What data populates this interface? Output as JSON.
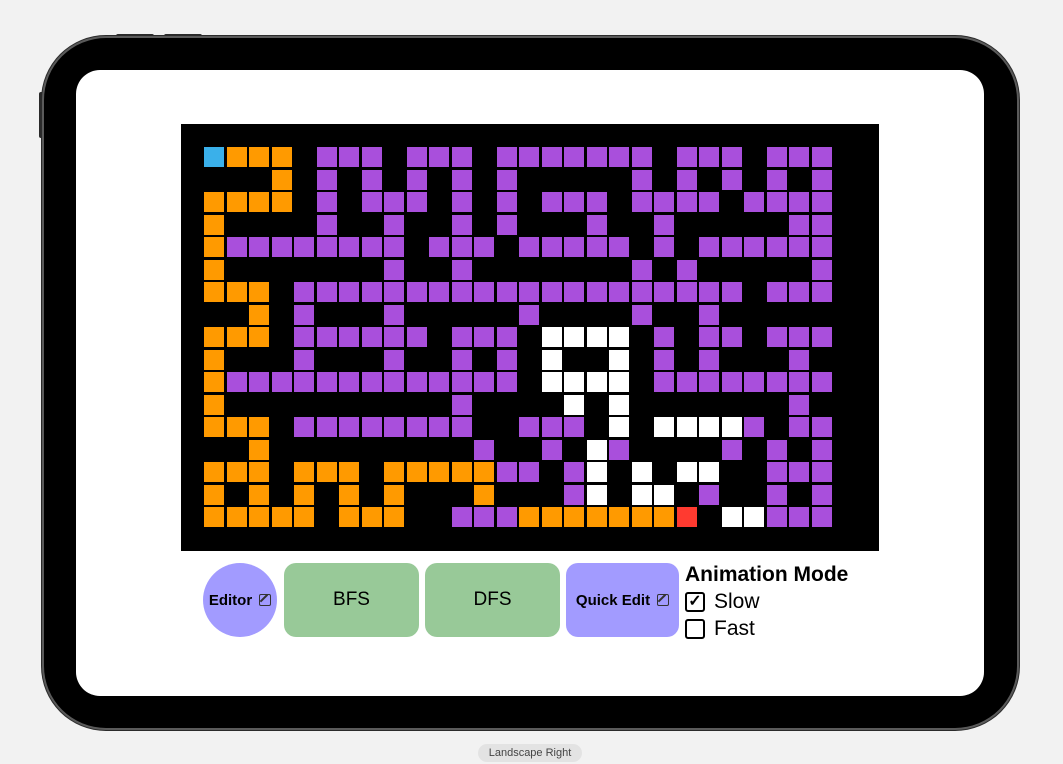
{
  "colors": {
    "wall": "#000000",
    "open": "#a94fdc",
    "path": "#ff9a00",
    "visited": "#ffffff",
    "start": "#3ab0ea",
    "end": "#ff3a30"
  },
  "maze": {
    "rows": 17,
    "cols": 29,
    "legend": {
      ".": "wall",
      "o": "open",
      "p": "path",
      "w": "visited",
      "s": "start",
      "e": "end"
    },
    "grid": [
      ".............................",
      ".sppp.ooo.ooo.ooooooo.ooo.ooo",
      "....p.o.o.o.o.o.....o.o.o.o.o",
      ".pppp.o.ooo.o.o.ooo.oooo.oooo",
      ".p....o..o..o.o...o..o.....oo",
      ".poooooooo.ooo.ooooo.o.oooooo",
      ".p.......o..o.......o.o.....o",
      ".ppp.oooooooooooooooooooo.oooo",
      "...p.o...o.....o....o..o.....",
      ".ppp.oooooo.ooo.wwww.o.oo.ooo",
      ".p...o...o..o.o.w..w.o.o...o.",
      ".pooooooooooooo.wwww.oooooooo",
      ".p..........o....w.w.......o.",
      ".ppp.oooooooo..ooo.w.wwwwo.oo",
      "...p.........o..o.wo....o.o.o",
      ".ppp.ppp.pppppoo.ow.w.ww..ooo",
      ".p.p.p.p.p...p...ow.ww.o..o.o"
    ],
    "bottom_row": ".ppppp.ppp..ooopppppppe.wwooooo.o"
  },
  "buttons": {
    "editor": "Editor",
    "bfs": "BFS",
    "dfs": "DFS",
    "quick_edit": "Quick Edit"
  },
  "animation": {
    "title": "Animation Mode",
    "options": [
      {
        "label": "Slow",
        "checked": true
      },
      {
        "label": "Fast",
        "checked": false
      }
    ]
  },
  "orientation_label": "Landscape Right",
  "icons": {
    "editor": "square-and-pencil-icon",
    "quick_edit": "square-and-pencil-icon",
    "checked": "checkmark-square-icon",
    "unchecked": "empty-square-icon"
  }
}
